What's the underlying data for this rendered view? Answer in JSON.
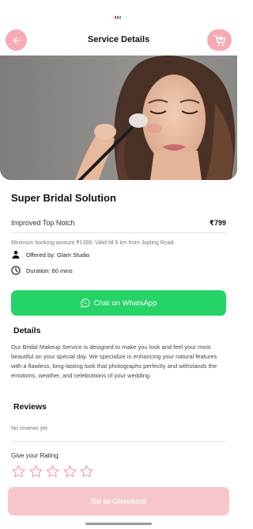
{
  "header": {
    "title": "Service Details"
  },
  "service": {
    "title": "Super Bridal Solution",
    "variant": "Improved Top Notch",
    "price": "₹799",
    "min_booking": "Minimum booking amount ₹1399. Valid till 5 km from Jopling Road.",
    "offered_by": "Offered by: Glam Studio",
    "duration": "Duration: 60 mins"
  },
  "actions": {
    "whatsapp_label": "Chat on WhatsApp",
    "checkout_label": "Go to Checkout"
  },
  "details": {
    "heading": "Details",
    "text": "Our Bridal Makeup Service is designed to make you look and feel your most beautiful on your special day. We specialize in enhancing your natural features with a flawless, long-lasting look that photographs perfectly and withstands the emotions, weather, and celebrations of your wedding."
  },
  "reviews": {
    "heading": "Reviews",
    "empty_text": "No reviews yet",
    "rating_label": "Give your Rating:",
    "star_count": 5
  },
  "colors": {
    "accent_pink": "#f7aab3",
    "checkout_disabled": "#f7c6cb",
    "whatsapp_green": "#25d366"
  },
  "icons": {
    "back": "arrow-left-icon",
    "cart": "cart-icon",
    "provider": "person-icon",
    "duration": "clock-icon",
    "whatsapp": "whatsapp-icon",
    "star": "star-outline-icon"
  }
}
